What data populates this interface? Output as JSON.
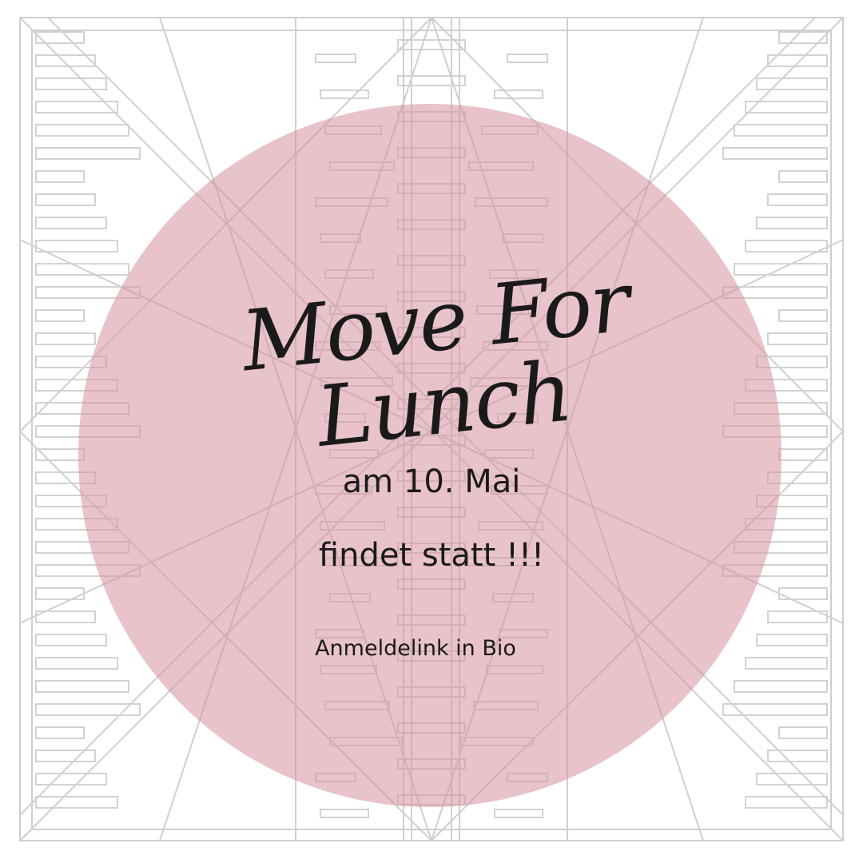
{
  "post": {
    "title": "Move For Lunch",
    "date_line": "am 10. Mai",
    "status_line": "findet statt !!!",
    "note_line": "Anmeldelink in Bio"
  },
  "colors": {
    "background": "#ffffff",
    "circle": "#e3b8bf",
    "line_art": "#c9c9c9",
    "text": "#1a1a1a"
  }
}
